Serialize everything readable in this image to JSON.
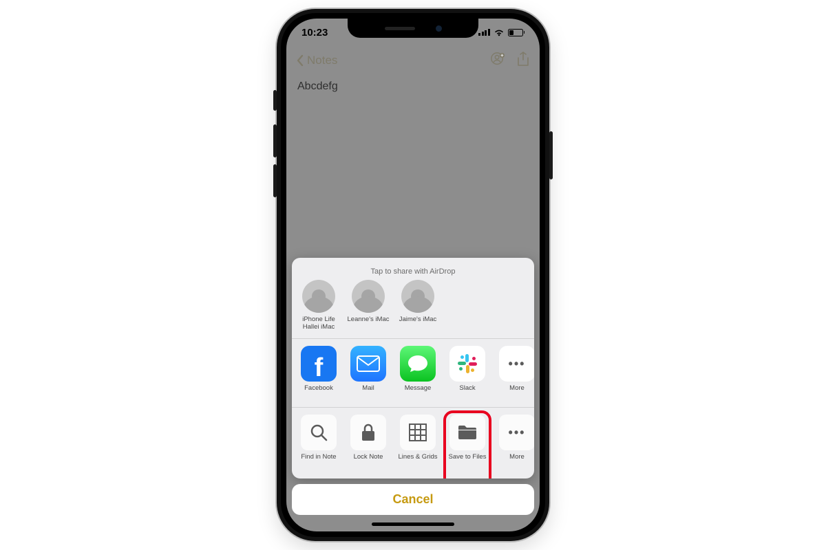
{
  "status": {
    "time": "10:23"
  },
  "notes": {
    "back_label": "Notes",
    "content": "Abcdefg"
  },
  "share": {
    "airdrop_header": "Tap to share with AirDrop",
    "contacts": [
      {
        "label": "iPhone Life Hallei iMac"
      },
      {
        "label": "Leanne's iMac"
      },
      {
        "label": "Jaime's iMac"
      }
    ],
    "apps": [
      {
        "name": "facebook",
        "label": "Facebook"
      },
      {
        "name": "mail",
        "label": "Mail"
      },
      {
        "name": "message",
        "label": "Message"
      },
      {
        "name": "slack",
        "label": "Slack"
      },
      {
        "name": "more",
        "label": "More"
      }
    ],
    "actions": [
      {
        "name": "find-in-note",
        "label": "Find in Note"
      },
      {
        "name": "lock-note",
        "label": "Lock Note"
      },
      {
        "name": "lines-grids",
        "label": "Lines & Grids"
      },
      {
        "name": "save-to-files",
        "label": "Save to Files"
      },
      {
        "name": "more",
        "label": "More"
      }
    ],
    "cancel_label": "Cancel"
  },
  "colors": {
    "facebook": "#1877F2",
    "highlight": "#e8001f",
    "cancel_text": "#c69a11"
  }
}
